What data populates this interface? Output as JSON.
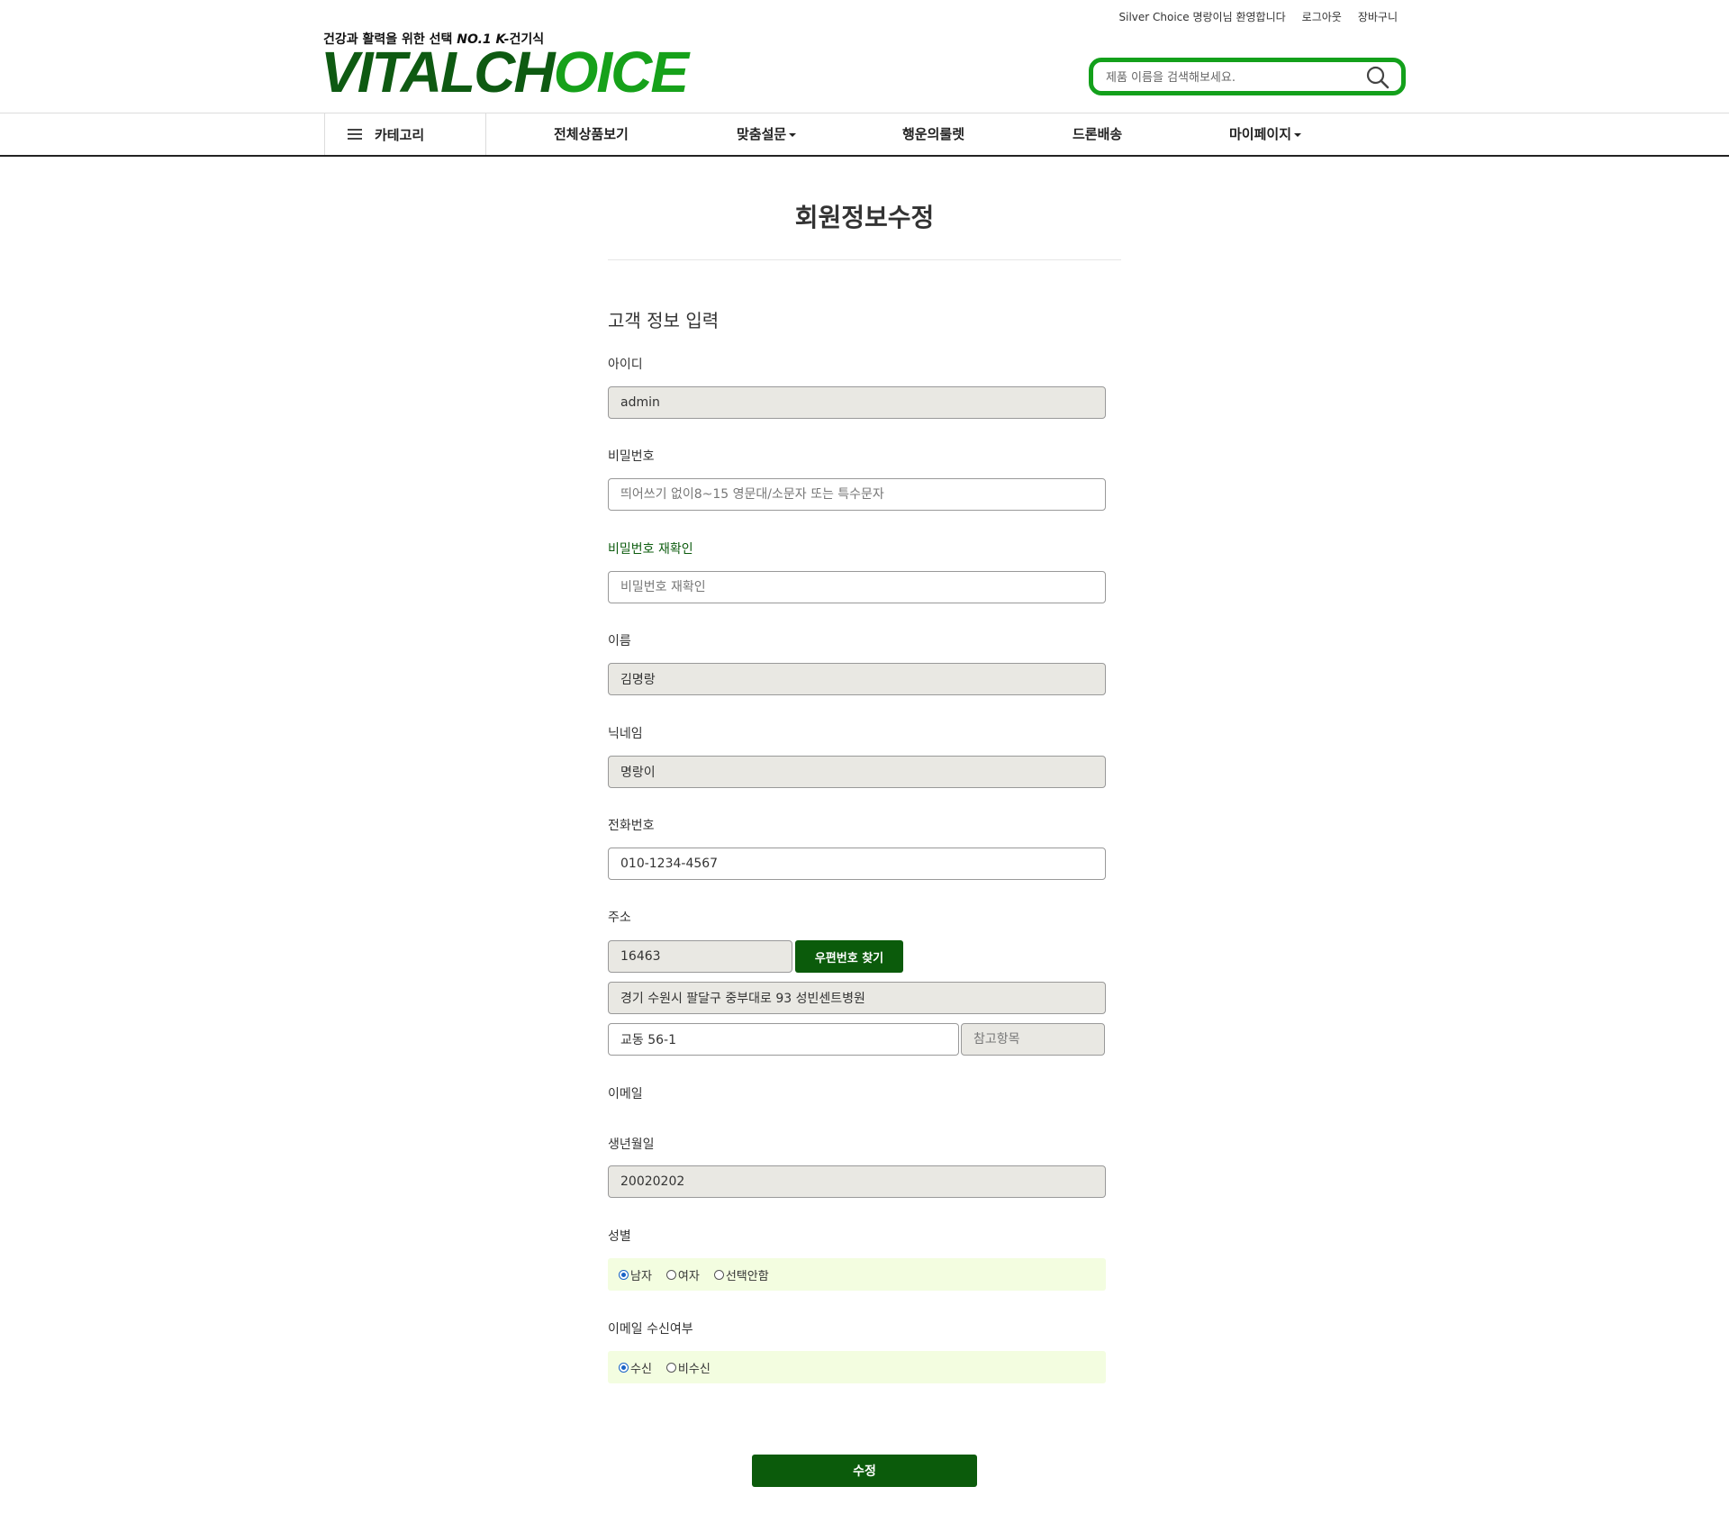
{
  "header": {
    "welcome": "Silver Choice 명랑이님 환영합니다",
    "logout": "로그아웃",
    "cart": "장바구니",
    "tagline_prefix": "건강과 활력을 위한 선택 ",
    "tagline_em": "NO.1 K-",
    "tagline_suffix": "건기식",
    "logo_part1": "VITALCH",
    "logo_part2": "O",
    "logo_part3": "ICE",
    "search_placeholder": "제품 이름을 검색해보세요."
  },
  "nav": {
    "category": "카테고리",
    "items": [
      "전체상품보기",
      "맞춤설문",
      "행운의룰렛",
      "드론배송",
      "마이페이지"
    ]
  },
  "page": {
    "title": "회원정보수정",
    "section_title": "고객 정보 입력"
  },
  "form": {
    "id_label": "아이디",
    "id_value": "admin",
    "password_label": "비밀번호",
    "password_placeholder": "띄어쓰기 없이8~15 영문대/소문자 또는 특수문자",
    "password_confirm_label": "비밀번호 재확인",
    "password_confirm_placeholder": "비밀번호 재확인",
    "name_label": "이름",
    "name_value": "김명랑",
    "nickname_label": "닉네임",
    "nickname_value": "명랑이",
    "phone_label": "전화번호",
    "phone_value": "010-1234-4567",
    "address_label": "주소",
    "zipcode_value": "16463",
    "zip_button": "우편번호 찾기",
    "address_value": "경기 수원시 팔달구 중부대로 93 성빈센트병원",
    "address_detail_value": "교동 56-1",
    "address_extra_placeholder": "참고항목",
    "email_label": "이메일",
    "birth_label": "생년월일",
    "birth_value": "20020202",
    "gender_label": "성별",
    "gender_options": [
      "남자",
      "여자",
      "선택안함"
    ],
    "gender_selected": "남자",
    "email_consent_label": "이메일 수신여부",
    "email_consent_options": [
      "수신",
      "비수신"
    ],
    "email_consent_selected": "수신",
    "submit_label": "수정"
  },
  "colors": {
    "brand_green": "#0b5b0b",
    "search_border": "#13a01b",
    "radio_bg": "#f3fde0",
    "readonly_bg": "#e9e8e3"
  }
}
